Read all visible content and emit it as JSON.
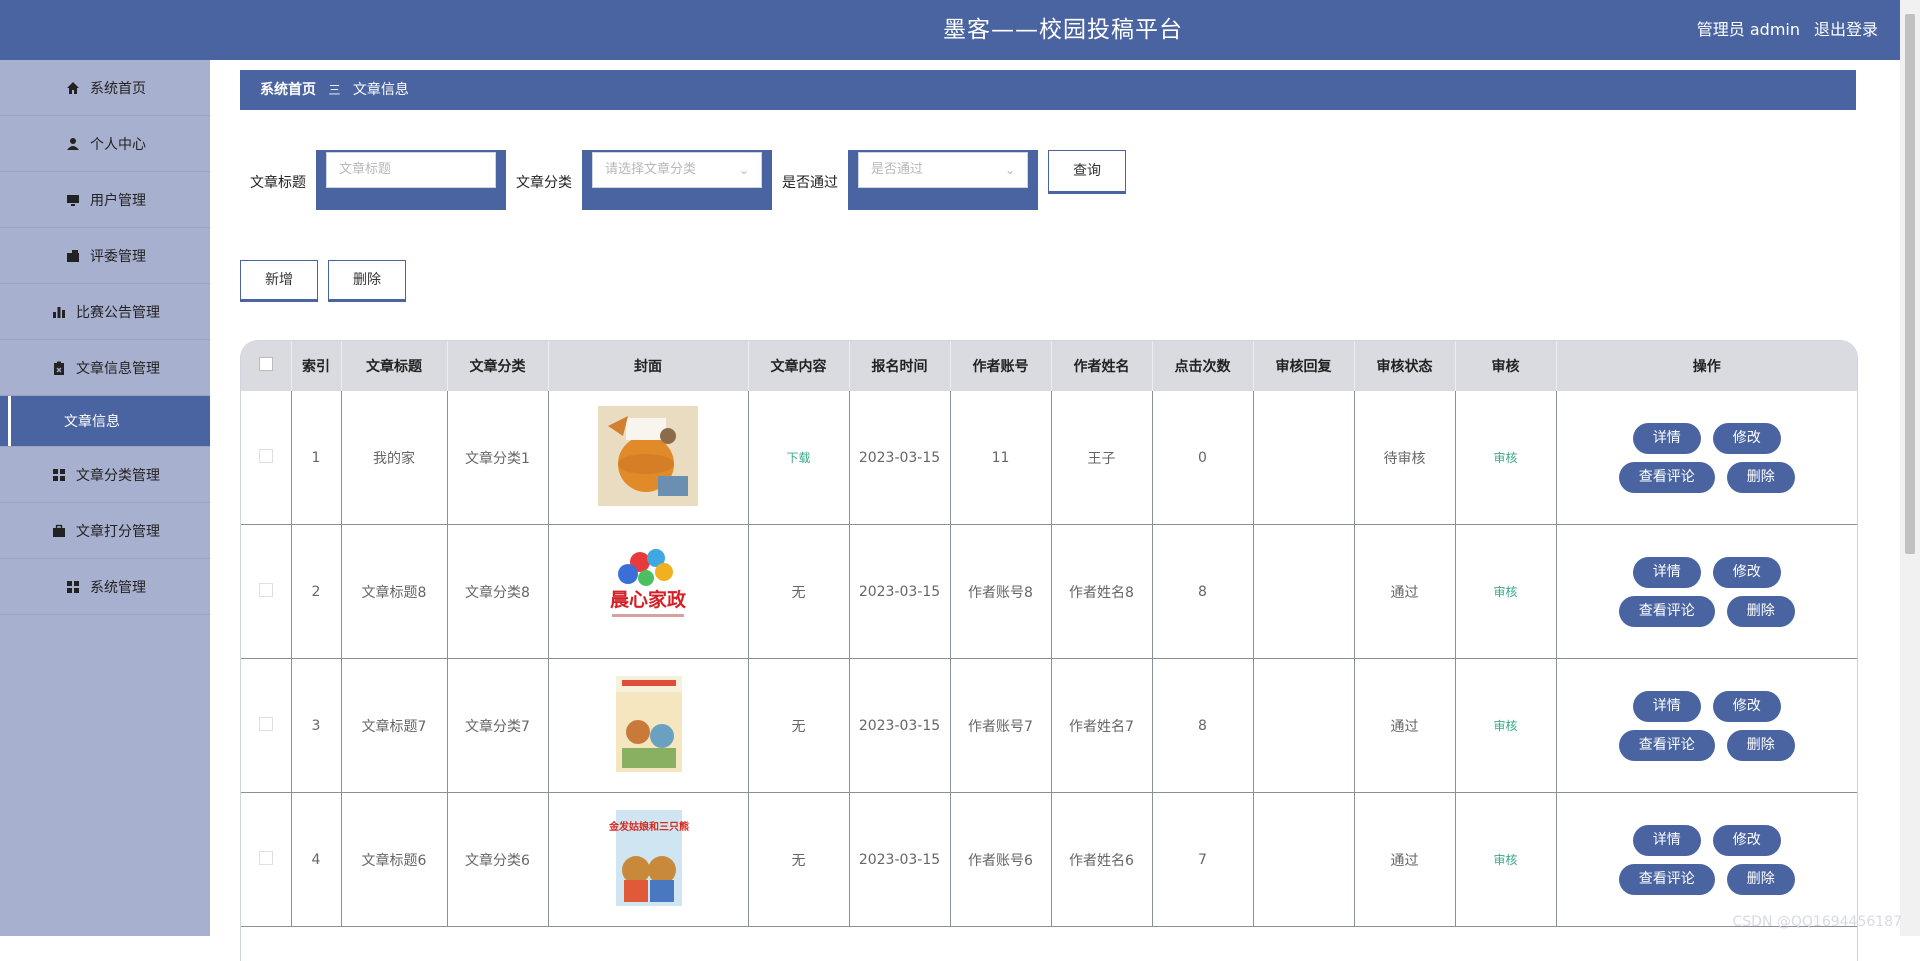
{
  "header": {
    "title": "墨客——校园投稿平台",
    "user": "管理员 admin",
    "logout": "退出登录"
  },
  "sidebar": {
    "items": [
      {
        "label": "系统首页",
        "icon": "home-icon"
      },
      {
        "label": "个人中心",
        "icon": "user-icon"
      },
      {
        "label": "用户管理",
        "icon": "monitor-icon"
      },
      {
        "label": "评委管理",
        "icon": "folder-icon"
      },
      {
        "label": "比赛公告管理",
        "icon": "bar-chart-icon"
      },
      {
        "label": "文章信息管理",
        "icon": "clipboard-icon"
      },
      {
        "label": "文章信息",
        "icon": ""
      },
      {
        "label": "文章分类管理",
        "icon": "grid-icon"
      },
      {
        "label": "文章打分管理",
        "icon": "briefcase-icon"
      },
      {
        "label": "系统管理",
        "icon": "grid-icon"
      }
    ]
  },
  "breadcrumb": {
    "home": "系统首页",
    "sep": "三",
    "current": "文章信息"
  },
  "search": {
    "title_label": "文章标题",
    "title_placeholder": "文章标题",
    "category_label": "文章分类",
    "category_placeholder": "请选择文章分类",
    "passed_label": "是否通过",
    "passed_placeholder": "是否通过",
    "query": "查询"
  },
  "actions": {
    "add": "新增",
    "delete": "删除"
  },
  "table": {
    "headers": [
      "",
      "索引",
      "文章标题",
      "文章分类",
      "封面",
      "文章内容",
      "报名时间",
      "作者账号",
      "作者姓名",
      "点击次数",
      "审核回复",
      "审核状态",
      "审核",
      "操作"
    ],
    "rows": [
      {
        "index": "1",
        "title": "我的家",
        "category": "文章分类1",
        "cover": "orange-illustration",
        "content": "下载",
        "time": "2023-03-15",
        "account": "11",
        "name": "王子",
        "clicks": "0",
        "reply": "",
        "status": "待审核",
        "audit": "审核"
      },
      {
        "index": "2",
        "title": "文章标题8",
        "category": "文章分类8",
        "cover": "晨心家政",
        "content": "无",
        "time": "2023-03-15",
        "account": "作者账号8",
        "name": "作者姓名8",
        "clicks": "8",
        "reply": "",
        "status": "通过",
        "audit": "审核"
      },
      {
        "index": "3",
        "title": "文章标题7",
        "category": "文章分类7",
        "cover": "book-cover",
        "content": "无",
        "time": "2023-03-15",
        "account": "作者账号7",
        "name": "作者姓名7",
        "clicks": "8",
        "reply": "",
        "status": "通过",
        "audit": "审核"
      },
      {
        "index": "4",
        "title": "文章标题6",
        "category": "文章分类6",
        "cover": "金发姑娘和三只熊",
        "content": "无",
        "time": "2023-03-15",
        "account": "作者账号6",
        "name": "作者姓名6",
        "clicks": "7",
        "reply": "",
        "status": "通过",
        "audit": "审核"
      }
    ],
    "ops": {
      "detail": "详情",
      "edit": "修改",
      "comments": "查看评论",
      "delete": "删除"
    }
  },
  "watermark": "CSDN @QQ1694456187",
  "colors": {
    "primary": "#4a64a2",
    "sidebar": "#a8b0cf",
    "green": "#3aaa8b"
  }
}
